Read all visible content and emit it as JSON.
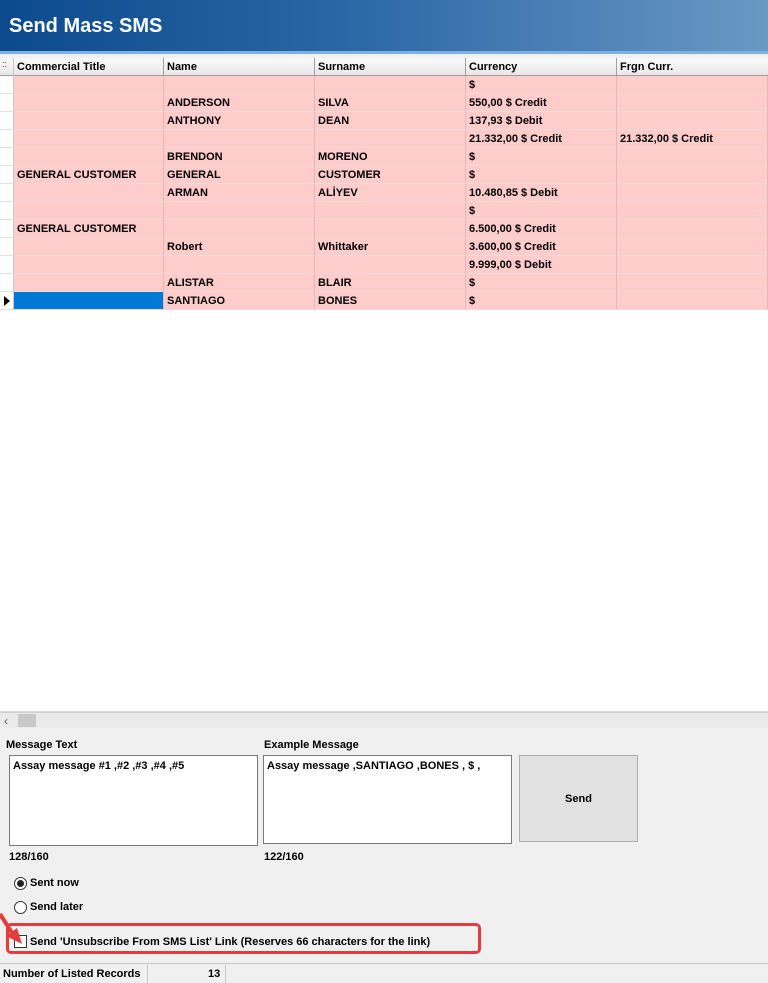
{
  "window": {
    "title": "Send Mass SMS"
  },
  "grid": {
    "columns": [
      "Commercial Title",
      "Name",
      "Surname",
      "Currency",
      "Frgn Curr."
    ],
    "rows": [
      [
        "",
        "",
        "",
        "$",
        ""
      ],
      [
        "",
        "ANDERSON",
        "SILVA",
        "550,00 $ Credit",
        ""
      ],
      [
        "",
        "ANTHONY",
        "DEAN",
        "137,93 $ Debit",
        ""
      ],
      [
        "",
        "",
        "",
        "21.332,00 $ Credit",
        "21.332,00 $ Credit"
      ],
      [
        "",
        "BRENDON",
        "MORENO",
        "$",
        ""
      ],
      [
        "GENERAL CUSTOMER",
        "GENERAL",
        "CUSTOMER",
        "$",
        ""
      ],
      [
        "",
        "ARMAN",
        "ALİYEV",
        "10.480,85 $ Debit",
        ""
      ],
      [
        "",
        "",
        "",
        "$",
        ""
      ],
      [
        "GENERAL CUSTOMER",
        "",
        "",
        "6.500,00 $ Credit",
        ""
      ],
      [
        "",
        "Robert",
        "Whittaker",
        "3.600,00 $ Credit",
        ""
      ],
      [
        "",
        "",
        "",
        "9.999,00 $ Debit",
        ""
      ],
      [
        "",
        "ALISTAR",
        "BLAIR",
        "$",
        ""
      ],
      [
        "",
        "SANTIAGO",
        "BONES",
        "$",
        ""
      ]
    ],
    "row_color": "#ffcccc",
    "selected_row_index": 12,
    "selection_color": "#0078d7"
  },
  "message": {
    "text_label": "Message Text",
    "text_value": "Assay message #1 ,#2 ,#3 ,#4 ,#5",
    "text_count": "128/160",
    "example_label": "Example Message",
    "example_value": "Assay message  ,SANTIAGO ,BONES , $  ,",
    "example_count": "122/160",
    "send_label": "Send"
  },
  "schedule": {
    "sent_now_label": "Sent now",
    "send_later_label": "Send later",
    "selected": "sent_now"
  },
  "unsubscribe": {
    "label": "Send 'Unsubscribe From SMS List' Link (Reserves 66 characters for the link)",
    "checked": false,
    "highlight_color": "#e53b3b"
  },
  "status": {
    "records_label": "Number of Listed Records",
    "records_value": "13"
  }
}
